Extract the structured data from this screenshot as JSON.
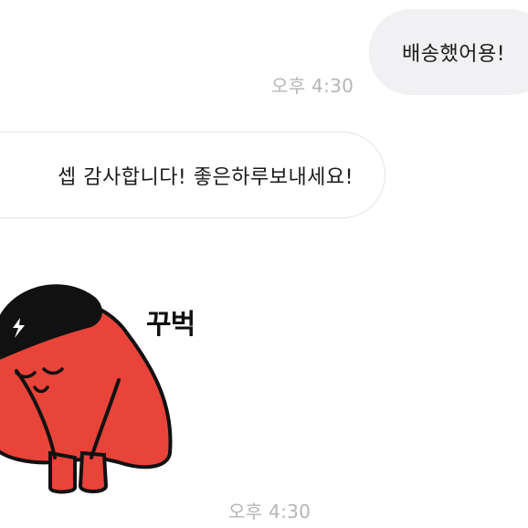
{
  "messages": {
    "outgoing_text": "배송했어용!",
    "outgoing_time": "오후 4:30",
    "incoming_text": "셉 감사합니다! 좋은하루보내세요!",
    "sticker_caption": "꾸벅",
    "sticker_time": "오후 4:30"
  },
  "colors": {
    "outgoing_bubble": "#f1f1f3",
    "incoming_border": "#e4e4e6",
    "timestamp": "#b5b5b5",
    "sticker_body": "#e8443a",
    "sticker_hat": "#111111"
  },
  "icons": {
    "sticker": "bowing-red-character-sticker"
  }
}
